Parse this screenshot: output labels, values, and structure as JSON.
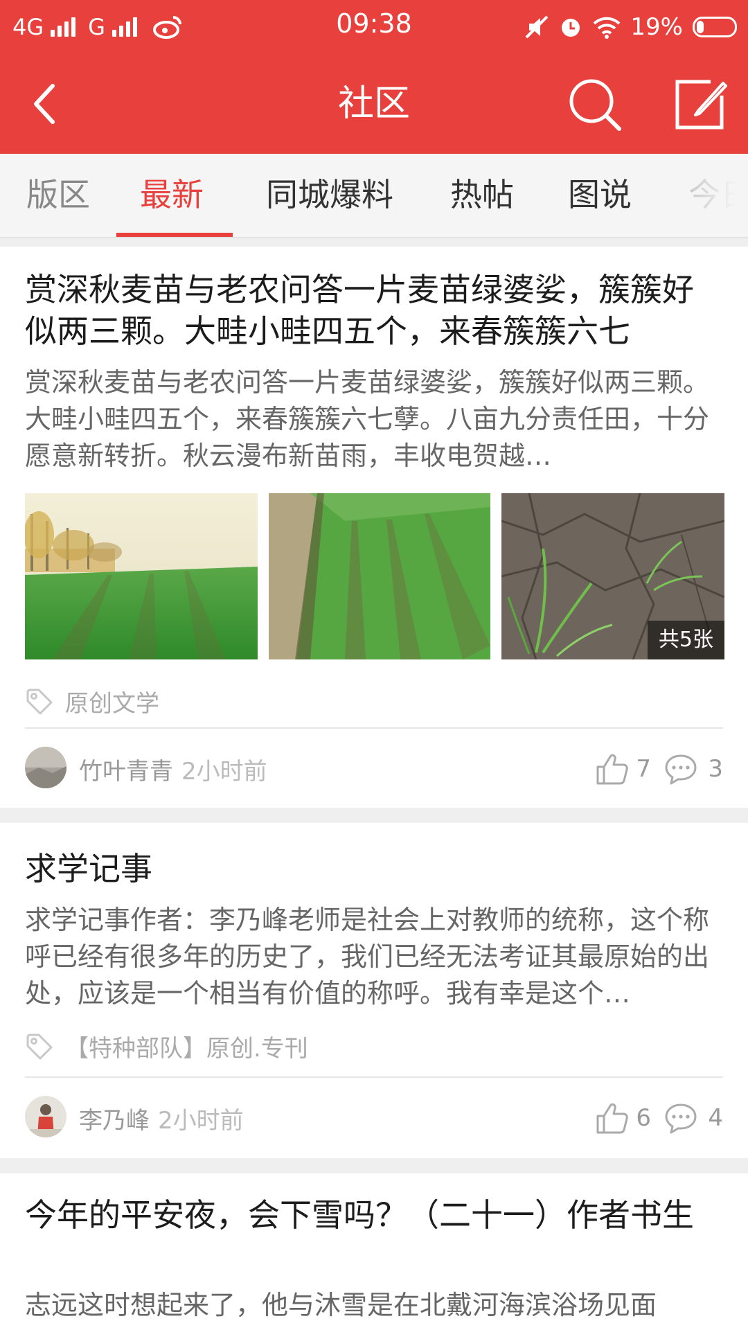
{
  "status_bar": {
    "network_1": "4G",
    "network_2": "G",
    "time": "09:38",
    "battery": "19%",
    "battery_level": 0.19,
    "icons": [
      "signal-icon",
      "weibo-icon",
      "mute-icon",
      "alarm-icon",
      "wifi-icon",
      "battery-icon"
    ]
  },
  "header": {
    "title": "社区",
    "icons": [
      "back-arrow-icon",
      "search-icon",
      "edit-icon"
    ]
  },
  "tabs": [
    {
      "label": "版区",
      "active": false
    },
    {
      "label": "最新",
      "active": true
    },
    {
      "label": "同城爆料",
      "active": false
    },
    {
      "label": "热帖",
      "active": false
    },
    {
      "label": "图说",
      "active": false
    },
    {
      "label": "今日",
      "active": false
    }
  ],
  "posts": [
    {
      "title": "赏深秋麦苗与老农问答一片麦苗绿婆娑，簇簇好似两三颗。大畦小畦四五个，来春簇簇六七",
      "excerpt": "赏深秋麦苗与老农问答一片麦苗绿婆娑，簇簇好似两三颗。大畦小畦四五个，来春簇簇六七孽。八亩九分责任田，十分愿意新转折。秋云漫布新苗雨，丰收电贺越…",
      "photo_count": "共5张",
      "tag": "原创文学",
      "author": "竹叶青青",
      "time": "2小时前",
      "likes": "7",
      "comments": "3"
    },
    {
      "title": "求学记事",
      "excerpt": "求学记事作者：李乃峰老师是社会上对教师的统称，这个称呼已经有很多年的历史了，我们已经无法考证其最原始的出处，应该是一个相当有价值的称呼。我有幸是这个…",
      "tag": "【特种部队】原创.专刊",
      "author": "李乃峰",
      "time": "2小时前",
      "likes": "6",
      "comments": "4"
    },
    {
      "title": "今年的平安夜，会下雪吗？（二十一）作者书生",
      "excerpt": "志远这时想起来了，他与沐雪是在北戴河海滨浴场见面"
    }
  ],
  "colors": {
    "brand": "#e8413d",
    "text_primary": "#1c1c1c",
    "text_secondary": "#666666",
    "text_muted": "#999999"
  }
}
